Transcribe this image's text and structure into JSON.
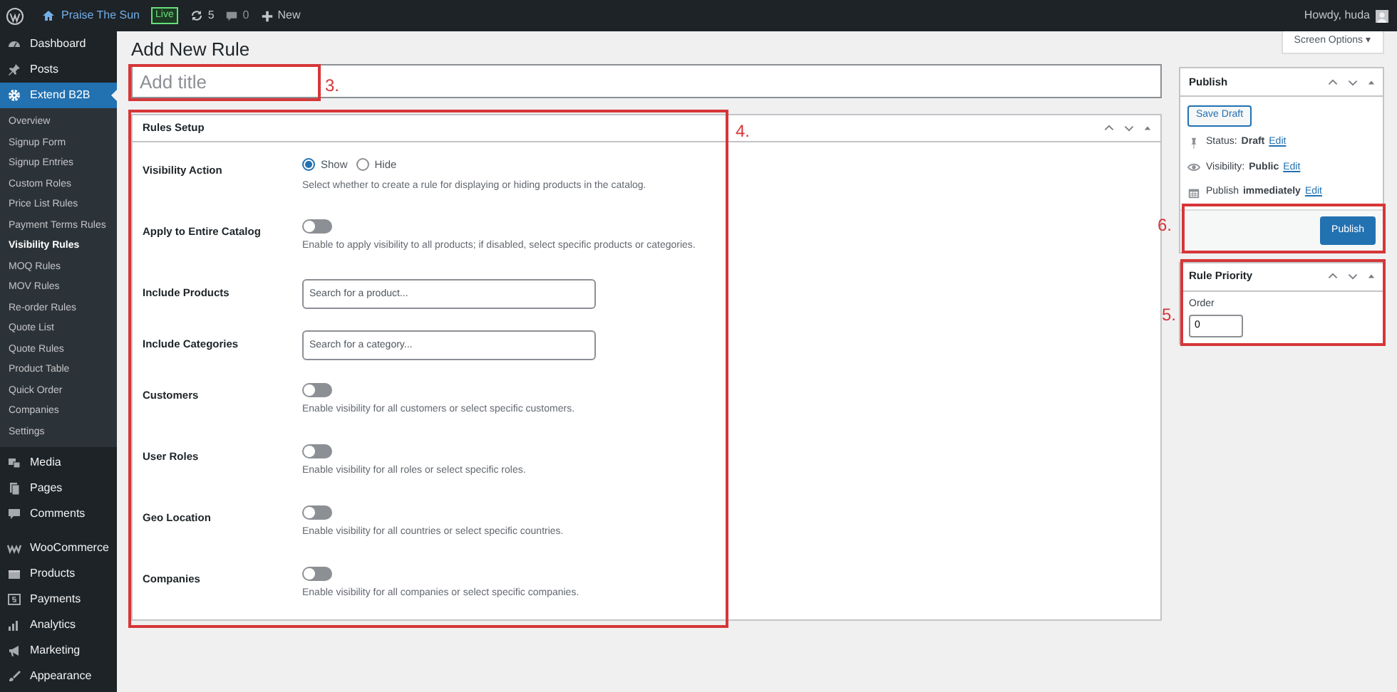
{
  "admin_bar": {
    "site": "Praise The Sun",
    "badge": "Live",
    "updates": "5",
    "comments": "0",
    "new": "New",
    "greeting": "Howdy, huda"
  },
  "sidebar": {
    "items": [
      {
        "label": "Dashboard",
        "selected": false
      },
      {
        "label": "Posts",
        "selected": false
      },
      {
        "label": "Extend B2B",
        "selected": true,
        "children": [
          {
            "label": "Overview",
            "selected": false
          },
          {
            "label": "Signup Form",
            "selected": false
          },
          {
            "label": "Signup Entries",
            "selected": false
          },
          {
            "label": "Custom Roles",
            "selected": false
          },
          {
            "label": "Price List Rules",
            "selected": false
          },
          {
            "label": "Payment Terms Rules",
            "selected": false
          },
          {
            "label": "Visibility Rules",
            "selected": true
          },
          {
            "label": "MOQ Rules",
            "selected": false
          },
          {
            "label": "MOV Rules",
            "selected": false
          },
          {
            "label": "Re-order Rules",
            "selected": false
          },
          {
            "label": "Quote List",
            "selected": false
          },
          {
            "label": "Quote Rules",
            "selected": false
          },
          {
            "label": "Product Table",
            "selected": false
          },
          {
            "label": "Quick Order",
            "selected": false
          },
          {
            "label": "Companies",
            "selected": false
          },
          {
            "label": "Settings",
            "selected": false
          }
        ]
      },
      {
        "label": "Media",
        "selected": false
      },
      {
        "label": "Pages",
        "selected": false
      },
      {
        "label": "Comments",
        "selected": false
      },
      {
        "label": "WooCommerce",
        "selected": false
      },
      {
        "label": "Products",
        "selected": false
      },
      {
        "label": "Payments",
        "selected": false
      },
      {
        "label": "Analytics",
        "selected": false
      },
      {
        "label": "Marketing",
        "selected": false
      },
      {
        "label": "Appearance",
        "selected": false
      }
    ]
  },
  "screen_options": "Screen Options ▾",
  "page_title": "Add New Rule",
  "title_field": {
    "placeholder": "Add title"
  },
  "rules_setup": {
    "title": "Rules Setup",
    "rows": [
      {
        "kind": "radio",
        "label": "Visibility Action",
        "options": [
          {
            "label": "Show",
            "selected": true
          },
          {
            "label": "Hide",
            "selected": false
          }
        ],
        "help": "Select whether to create a rule for displaying or hiding products in the catalog."
      },
      {
        "kind": "toggle",
        "label": "Apply to Entire Catalog",
        "on": false,
        "help": "Enable to apply visibility to all products; if disabled, select specific products or categories."
      },
      {
        "kind": "search",
        "label": "Include Products",
        "placeholder": "Search for a product..."
      },
      {
        "kind": "search",
        "label": "Include Categories",
        "placeholder": "Search for a category..."
      },
      {
        "kind": "toggle",
        "label": "Customers",
        "on": false,
        "help": "Enable visibility for all customers or select specific customers."
      },
      {
        "kind": "toggle",
        "label": "User Roles",
        "on": false,
        "help": "Enable visibility for all roles or select specific roles."
      },
      {
        "kind": "toggle",
        "label": "Geo Location",
        "on": false,
        "help": "Enable visibility for all countries or select specific countries."
      },
      {
        "kind": "toggle",
        "label": "Companies",
        "on": false,
        "help": "Enable visibility for all companies or select specific companies."
      }
    ]
  },
  "publish": {
    "title": "Publish",
    "save_draft": "Save Draft",
    "status_label": "Status:",
    "status": "Draft",
    "visibility_label": "Visibility:",
    "visibility": "Public",
    "schedule_label": "Publish",
    "schedule": "immediately",
    "edit_links": [
      "Edit",
      "Edit",
      "Edit"
    ],
    "button": "Publish"
  },
  "rule_priority": {
    "title": "Rule Priority",
    "field_label": "Order",
    "value": "0"
  },
  "annotations": [
    {
      "label": "3."
    },
    {
      "label": "4."
    },
    {
      "label": "6."
    },
    {
      "label": "5."
    }
  ]
}
